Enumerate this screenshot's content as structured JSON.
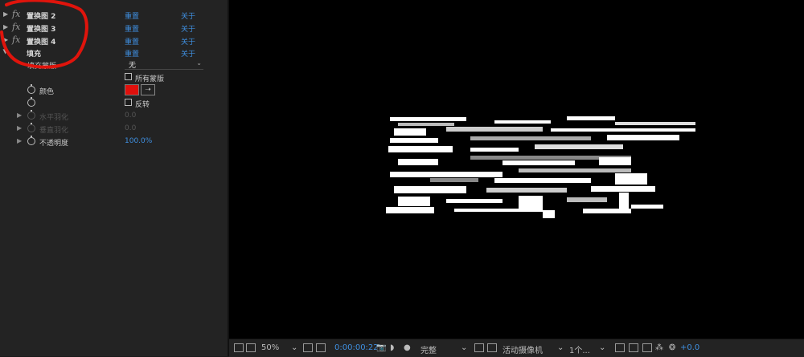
{
  "effects": [
    {
      "name": "置换图 2",
      "reset": "重置",
      "about": "关于"
    },
    {
      "name": "置换图 3",
      "reset": "重置",
      "about": "关于"
    },
    {
      "name": "置换图 4",
      "reset": "重置",
      "about": "关于"
    },
    {
      "name": "填充",
      "reset": "重置",
      "about": "关于"
    }
  ],
  "fill": {
    "mask_label": "填充蒙版",
    "mask_value": "无",
    "all_masks_label": "所有蒙版",
    "color_label": "颜色",
    "invert_label": "反转",
    "h_feather_label": "水平羽化",
    "h_feather_value": "0.0",
    "v_feather_label": "垂直羽化",
    "v_feather_value": "0.0",
    "opacity_label": "不透明度",
    "opacity_value": "100.0%",
    "color_value": "#e0100c"
  },
  "toolbar": {
    "zoom": "50%",
    "timecode": "0:00:00:22",
    "resolution": "完整",
    "camera": "活动摄像机",
    "views": "1个...",
    "exposure": "+0.0"
  }
}
